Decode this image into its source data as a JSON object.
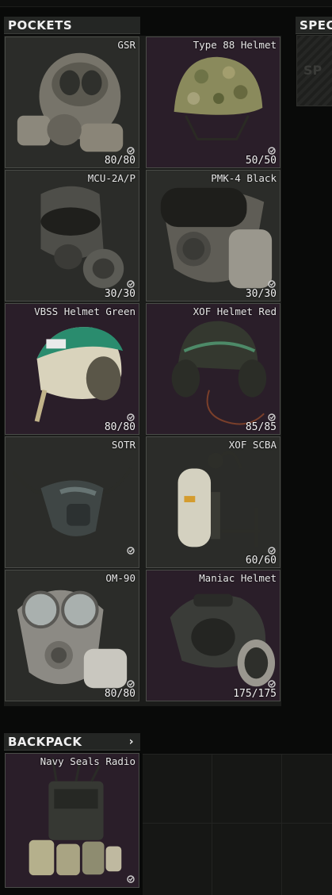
{
  "pockets": {
    "title": "POCKETS",
    "items": [
      {
        "name": "GSR",
        "durability": "80/80",
        "bg": "gray"
      },
      {
        "name": "Type 88 Helmet",
        "durability": "50/50",
        "bg": "purple"
      },
      {
        "name": "MCU-2A/P",
        "durability": "30/30",
        "bg": "gray"
      },
      {
        "name": "PMK-4 Black",
        "durability": "30/30",
        "bg": "gray"
      },
      {
        "name": "VBSS Helmet Green",
        "durability": "80/80",
        "bg": "purple"
      },
      {
        "name": "XOF Helmet Red",
        "durability": "85/85",
        "bg": "purple"
      },
      {
        "name": "SOTR",
        "durability": "",
        "bg": "gray"
      },
      {
        "name": "XOF SCBA",
        "durability": "60/60",
        "bg": "gray"
      },
      {
        "name": "OM-90",
        "durability": "80/80",
        "bg": "gray"
      },
      {
        "name": "Maniac Helmet",
        "durability": "175/175",
        "bg": "purple"
      }
    ]
  },
  "special": {
    "title": "SPEC",
    "slot_label": "SP"
  },
  "backpack": {
    "title": "BACKPACK",
    "chevron": "›",
    "item": {
      "name": "Navy Seals Radio",
      "bg": "purple"
    }
  }
}
